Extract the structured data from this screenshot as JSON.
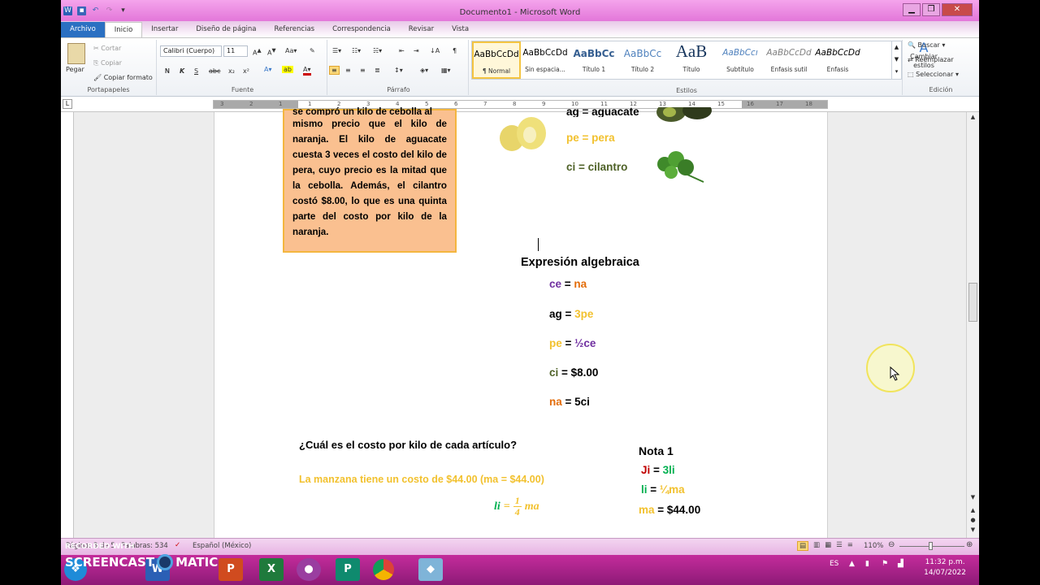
{
  "window": {
    "title": "Documento1 - Microsoft Word",
    "controls": [
      "▁",
      "❐",
      "✕"
    ]
  },
  "tabs": [
    "Archivo",
    "Inicio",
    "Insertar",
    "Diseño de página",
    "Referencias",
    "Correspondencia",
    "Revisar",
    "Vista"
  ],
  "ribbon": {
    "clipboard": {
      "paste": "Pegar",
      "cut": "Cortar",
      "copy": "Copiar",
      "format_painter": "Copiar formato",
      "label": "Portapapeles"
    },
    "font": {
      "family": "Calibri (Cuerpo)",
      "size": "11",
      "label": "Fuente",
      "buttons": [
        "N",
        "K",
        "S",
        "abc",
        "x₂",
        "x²"
      ]
    },
    "paragraph": {
      "label": "Párrafo",
      "pilcrow": "¶"
    },
    "styles": {
      "label": "Estilos",
      "items": [
        {
          "preview": "AaBbCcDd",
          "name": "¶ Normal"
        },
        {
          "preview": "AaBbCcDd",
          "name": "Sin espacia..."
        },
        {
          "preview": "AaBbCc",
          "name": "Título 1"
        },
        {
          "preview": "AaBbCc",
          "name": "Título 2"
        },
        {
          "preview": "AaB",
          "name": "Título"
        },
        {
          "preview": "AaBbCcı",
          "name": "Subtítulo"
        },
        {
          "preview": "AaBbCcDd",
          "name": "Énfasis sutil"
        },
        {
          "preview": "AaBbCcDd",
          "name": "Énfasis"
        }
      ],
      "change": "Cambiar estilos"
    },
    "editing": {
      "find": "Buscar",
      "replace": "Reemplazar",
      "select": "Seleccionar",
      "label": "Edición"
    }
  },
  "ruler_numbers": [
    "3",
    "2",
    "1",
    "1",
    "2",
    "3",
    "4",
    "5",
    "6",
    "7",
    "8",
    "9",
    "10",
    "11",
    "12",
    "13",
    "14",
    "15",
    "16",
    "17",
    "18"
  ],
  "document": {
    "problem_text": "mismo precio que el kilo de naranja. El kilo de aguacate cuesta 3 veces el costo del kilo de pera, cuyo precio es la mitad que la cebolla. Además, el cilantro costó $8.00, lo que es una quinta parte del costo por kilo de la naranja.",
    "problem_partial_top": "se compró un kilo de cebolla al",
    "legend": [
      {
        "code": "ag",
        "name": "aguacate"
      },
      {
        "code": "pe",
        "name": "pera"
      },
      {
        "code": "ci",
        "name": "cilantro"
      }
    ],
    "expression_heading": "Expresión algebraica",
    "expressions": [
      {
        "l": "ce",
        "op": " = ",
        "r": "na"
      },
      {
        "l": "ag",
        "op": " = ",
        "r": "3pe"
      },
      {
        "l": "pe",
        "op": " = ",
        "r": "½ce"
      },
      {
        "l": "ci",
        "op": " = ",
        "r": "$8.00"
      },
      {
        "l": "na",
        "op": " = ",
        "r": "5ci"
      }
    ],
    "question": "¿Cuál es el costo por kilo de cada artículo?",
    "answer1": "La manzana tiene un costo de $44.00 (ma = $44.00)",
    "formula": {
      "lhs": "li",
      "eq": "=",
      "num": "1",
      "den": "4",
      "rhs": "ma"
    },
    "note": {
      "title": "Nota 1",
      "lines": [
        {
          "l": "Ji",
          "op": " = ",
          "r": "3li"
        },
        {
          "l": "li",
          "op": " = ",
          "r": "¼ma"
        },
        {
          "l": "ma",
          "op": " = ",
          "r": "$44.00"
        }
      ]
    }
  },
  "status": {
    "page": "Página: 3 de 5",
    "words": "Palabras: 534",
    "lang": "Español (México)",
    "zoom": "110%"
  },
  "taskbar": {
    "lang": "ES",
    "time": "11:32 p.m.",
    "date": "14/07/2022"
  },
  "watermark": {
    "line1": "RECORDED WITH",
    "line2": "SCREENCAST",
    "line3": "MATIC"
  },
  "colors": {
    "title_pink": "#e070d6",
    "file_tab": "#2b70c2",
    "problem_bg": "#fac090",
    "taskbar": "#a8208a"
  }
}
